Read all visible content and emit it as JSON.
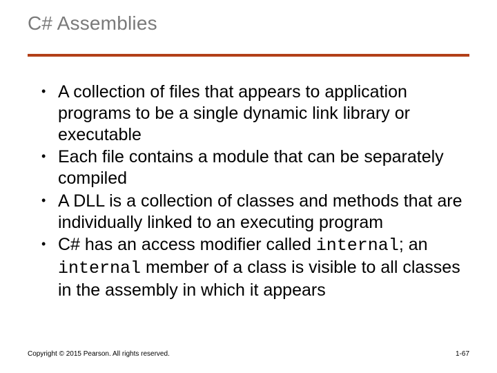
{
  "title": "C# Assemblies",
  "bullets": {
    "b1": "A collection of files that appears to application programs to be a single dynamic link library or executable",
    "b2": "Each file contains a module that can be separately compiled",
    "b3": "A DLL is a collection of classes and methods that are individually linked to an executing program",
    "b4_part1": "C# has an access modifier called ",
    "b4_code1": "internal",
    "b4_part2": "; an ",
    "b4_code2": "internal",
    "b4_part3": " member of a class is visible to all classes in the assembly in which it appears"
  },
  "footer": {
    "copyright": "Copyright © 2015 Pearson. All rights reserved.",
    "page": "1-67"
  }
}
